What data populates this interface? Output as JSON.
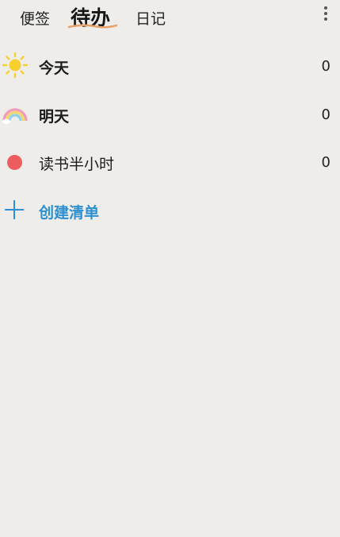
{
  "header": {
    "tabs": [
      {
        "label": "便签"
      },
      {
        "label": "待办",
        "active": true
      },
      {
        "label": "日记"
      }
    ],
    "more_icon": "more-vertical-icon",
    "underline_color": "#e8a36a"
  },
  "lists": [
    {
      "label": "今天",
      "count": "0",
      "icon": "sun-icon"
    },
    {
      "label": "明天",
      "count": "0",
      "icon": "rainbow-icon"
    },
    {
      "label": "读书半小时",
      "count": "0",
      "icon": "red-dot-icon"
    }
  ],
  "create": {
    "label": "创建清单",
    "icon": "plus-icon"
  },
  "colors": {
    "background": "#efede9",
    "accent": "#2b8fd1",
    "dot": "#ee5d5d",
    "sun": "#f7cf2e"
  }
}
